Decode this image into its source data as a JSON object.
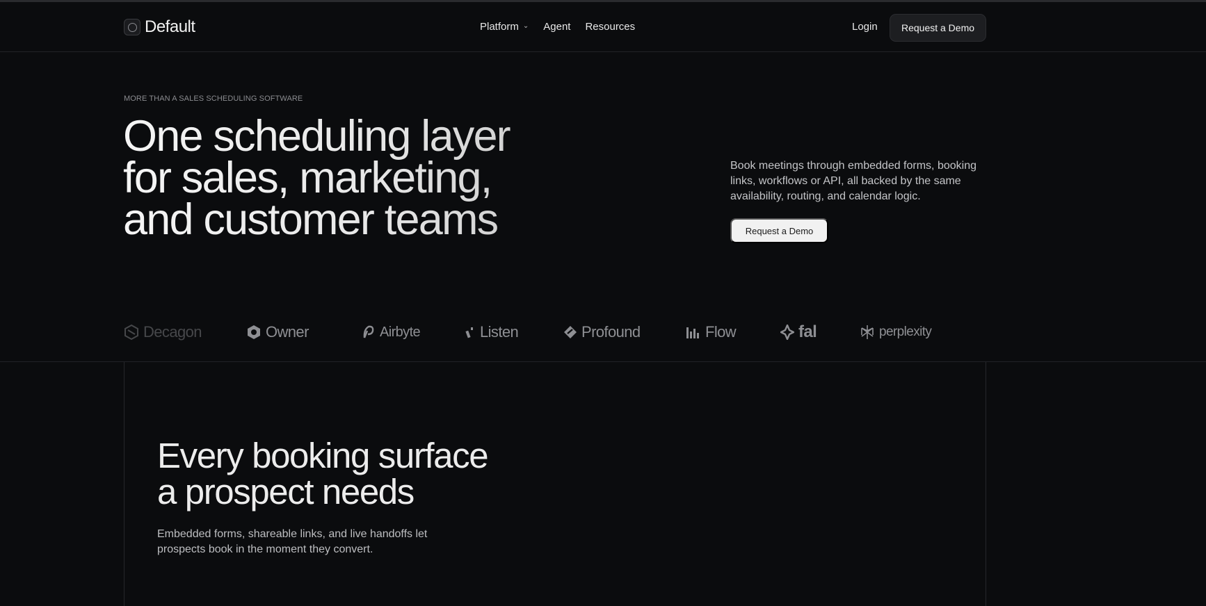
{
  "header": {
    "logo_text": "Default",
    "nav": [
      {
        "label": "Platform",
        "has_dropdown": true
      },
      {
        "label": "Agent",
        "has_dropdown": false
      },
      {
        "label": "Resources",
        "has_dropdown": false
      }
    ],
    "login_label": "Login",
    "demo_label": "Request a Demo"
  },
  "hero": {
    "eyebrow": "MORE THAN A SALES SCHEDULING SOFTWARE",
    "title_lines": [
      "One scheduling layer",
      "for sales, marketing,",
      "and customer teams"
    ],
    "description": "Book meetings through embedded forms, booking links, workflows or API, all backed by the same availability, routing, and calendar logic.",
    "cta_label": "Request a Demo"
  },
  "logos": [
    {
      "name": "Decagon",
      "icon": "decagon-icon"
    },
    {
      "name": "Owner",
      "icon": "owner-icon"
    },
    {
      "name": "Airbyte",
      "icon": "airbyte-icon"
    },
    {
      "name": "Listen",
      "icon": "listen-icon"
    },
    {
      "name": "Profound",
      "icon": "profound-icon"
    },
    {
      "name": "Flow",
      "icon": "flow-icon"
    },
    {
      "name": "fal",
      "icon": "fal-icon"
    },
    {
      "name": "perplexity",
      "icon": "perplexity-icon"
    }
  ],
  "section": {
    "title_lines": [
      "Every booking surface",
      "a prospect needs"
    ],
    "description": "Embedded forms, shareable links, and live handoffs let prospects book in the moment they convert."
  },
  "colors": {
    "background": "#0b0c0e",
    "text": "#e6e6e6",
    "muted": "#8e8f93",
    "button_dark": "#1d1e21",
    "button_light": "#f1f1f1"
  }
}
